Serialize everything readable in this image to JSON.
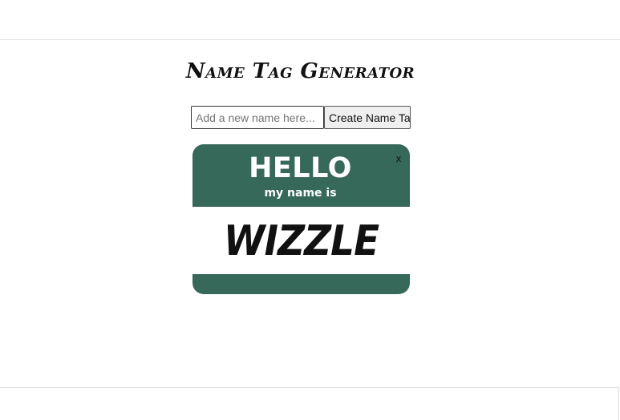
{
  "app": {
    "title": "Name Tag Generator"
  },
  "form": {
    "input_value": "",
    "input_placeholder": "Add a new name here...",
    "create_label": "Create Name Tag"
  },
  "name_tag": {
    "hello": "HELLO",
    "subtitle": "my name is",
    "name": "WIZZLE",
    "close_label": "x"
  },
  "colors": {
    "tag_green": "#37695b",
    "tag_name_background": "#ffffff",
    "page_background": "#ffffff"
  }
}
